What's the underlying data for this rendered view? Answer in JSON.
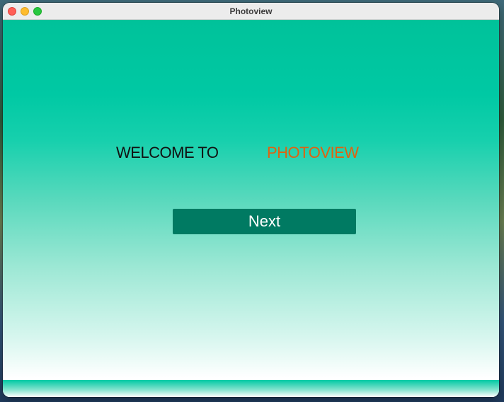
{
  "window": {
    "title": "Photoview"
  },
  "welcome": {
    "prefix": "WELCOME TO",
    "brand": "PHOTOVIEW"
  },
  "actions": {
    "next_label": "Next"
  },
  "colors": {
    "accent": "#00c9a4",
    "button": "#007a62",
    "brand_text": "#e0620f"
  }
}
